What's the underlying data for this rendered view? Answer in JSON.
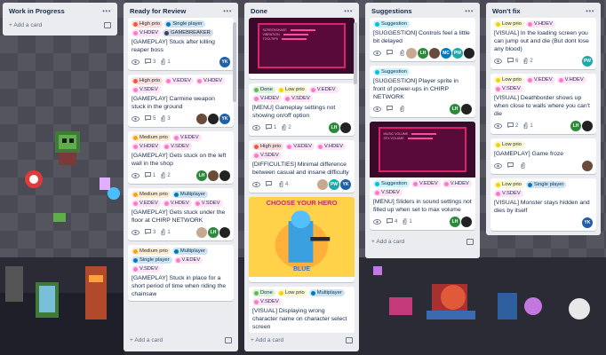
{
  "colors": {
    "yellow": "#f2d600",
    "green": "#61bd4f",
    "orange": "#ff9f1a",
    "red": "#eb5a46",
    "purple": "#c377e0",
    "pink": "#ff78cb",
    "blue": "#0079bf",
    "teal": "#00c2e0",
    "black": "#344563"
  },
  "add_card": "+ Add a card",
  "lists": [
    {
      "title": "Work in Progress",
      "cards": []
    },
    {
      "title": "Ready for Review",
      "cards": [
        {
          "labels": [
            {
              "t": "High prio",
              "c": "red"
            },
            {
              "t": "Single player",
              "c": "blue"
            },
            {
              "t": "V.HDEV",
              "c": "pink"
            },
            {
              "t": "GAMEBREAKER",
              "c": "black"
            }
          ],
          "title": "[GAMEPLAY] Stuck after killing reaper boss",
          "badges": {
            "watch": true,
            "comments": "3",
            "attach": "1"
          },
          "members": [
            "YK"
          ]
        },
        {
          "labels": [
            {
              "t": "High prio",
              "c": "red"
            },
            {
              "t": "V.EDEV",
              "c": "pink"
            },
            {
              "t": "V.HDEV",
              "c": "pink"
            },
            {
              "t": "V.SDEV",
              "c": "pink"
            }
          ],
          "title": "[GAMEPLAY] Carmine weapon stuck in the ground",
          "badges": {
            "watch": true,
            "comments": "5",
            "attach": "3"
          },
          "members": [
            "av-1",
            "av-2",
            "YK"
          ]
        },
        {
          "labels": [
            {
              "t": "Medium prio",
              "c": "orange"
            },
            {
              "t": "V.EDEV",
              "c": "pink"
            },
            {
              "t": "V.HDEV",
              "c": "pink"
            },
            {
              "t": "V.SDEV",
              "c": "pink"
            }
          ],
          "title": "[GAMEPLAY] Gets stuck on the left wall in the shop",
          "badges": {
            "watch": true,
            "comments": "1",
            "attach": "2"
          },
          "members": [
            "LH",
            "av-1",
            "av-2"
          ]
        },
        {
          "labels": [
            {
              "t": "Medium prio",
              "c": "orange"
            },
            {
              "t": "Multiplayer",
              "c": "blue"
            },
            {
              "t": "V.EDEV",
              "c": "pink"
            },
            {
              "t": "V.HDEV",
              "c": "pink"
            },
            {
              "t": "V.SDEV",
              "c": "pink"
            }
          ],
          "title": "[GAMEPLAY] Gets stuck under the floor at CHIRP NETWORK",
          "badges": {
            "watch": true,
            "comments": "3",
            "attach": "1"
          },
          "members": [
            "av-3",
            "LH",
            "av-2"
          ]
        },
        {
          "labels": [
            {
              "t": "Medium prio",
              "c": "orange"
            },
            {
              "t": "Multiplayer",
              "c": "blue"
            },
            {
              "t": "Single player",
              "c": "blue"
            },
            {
              "t": "V.EDEV",
              "c": "pink"
            },
            {
              "t": "V.SDEV",
              "c": "pink"
            }
          ],
          "title": "[GAMEPLAY] Stuck in place for a short period of time when riding the chainsaw",
          "badges": null,
          "members": []
        }
      ]
    },
    {
      "title": "Done",
      "cards": [
        {
          "cover": "menu-settings",
          "labels": [],
          "title": "",
          "badges": null,
          "members": []
        },
        {
          "labels": [
            {
              "t": "Done",
              "c": "green"
            },
            {
              "t": "Low prio",
              "c": "yellow"
            },
            {
              "t": "V.EDEV",
              "c": "pink"
            },
            {
              "t": "V.HDEV",
              "c": "pink"
            },
            {
              "t": "V.SDEV",
              "c": "pink"
            }
          ],
          "title": "[MENU] Gameplay settings not showing on/off option",
          "badges": {
            "watch": true,
            "comments": "1",
            "attach": "2"
          },
          "members": [
            "LH",
            "av-2"
          ]
        },
        {
          "labels": [
            {
              "t": "High prio",
              "c": "red"
            },
            {
              "t": "V.EDEV",
              "c": "pink"
            },
            {
              "t": "V.HDEV",
              "c": "pink"
            },
            {
              "t": "V.SDEV",
              "c": "pink"
            }
          ],
          "title": "[DIFFICULTIES] Minimal difference between casual and insane difficulty",
          "badges": {
            "watch": true,
            "comments": "",
            "attach": "4"
          },
          "members": [
            "av-3",
            "PW",
            "YK"
          ]
        },
        {
          "cover": "choose-hero",
          "labels": [],
          "title": "",
          "badges": null,
          "members": []
        },
        {
          "labels": [
            {
              "t": "Done",
              "c": "green"
            },
            {
              "t": "Low prio",
              "c": "yellow"
            },
            {
              "t": "Multiplayer",
              "c": "blue"
            },
            {
              "t": "V.SDEV",
              "c": "pink"
            }
          ],
          "title": "[VISUAL] Displaying wrong character name on character select screen",
          "badges": null,
          "members": []
        }
      ]
    },
    {
      "title": "Suggestions",
      "cards": [
        {
          "labels": [
            {
              "t": "Suggestion",
              "c": "teal"
            }
          ],
          "title": "[SUGGESTION] Controls feel a little bit delayed",
          "badges": {
            "watch": true,
            "comments": "",
            "attach": ""
          },
          "members": [
            "av-3",
            "LH",
            "av-1",
            "MC",
            "PW",
            "av-2",
            "YK"
          ]
        },
        {
          "labels": [
            {
              "t": "Suggestion",
              "c": "teal"
            }
          ],
          "title": "[SUGGESTION] Player sprite in front of power-ups in CHIRP NETWORK",
          "badges": {
            "watch": true,
            "comments": "",
            "attach": ""
          },
          "members": [
            "LH",
            "av-2"
          ]
        },
        {
          "cover": "music-volume",
          "labels": [
            {
              "t": "Suggestion",
              "c": "teal"
            },
            {
              "t": "V.EDEV",
              "c": "pink"
            },
            {
              "t": "V.HDEV",
              "c": "pink"
            },
            {
              "t": "V.SDEV",
              "c": "pink"
            }
          ],
          "title": "[MENU] Sliders in sound settings not filled up when set to max volume",
          "badges": {
            "watch": true,
            "comments": "4",
            "attach": "1"
          },
          "members": [
            "LH",
            "av-2"
          ]
        }
      ]
    },
    {
      "title": "Won't fix",
      "cards": [
        {
          "labels": [
            {
              "t": "Low prio",
              "c": "yellow"
            },
            {
              "t": "V.HDEV",
              "c": "pink"
            }
          ],
          "title": "[VISUAL] In the loading screen you can jump out and die (But dont lose any blood)",
          "badges": {
            "watch": true,
            "comments": "6",
            "attach": "2"
          },
          "members": [
            "PW"
          ]
        },
        {
          "labels": [
            {
              "t": "Low prio",
              "c": "yellow"
            },
            {
              "t": "V.EDEV",
              "c": "pink"
            },
            {
              "t": "V.HDEV",
              "c": "pink"
            },
            {
              "t": "V.SDEV",
              "c": "pink"
            }
          ],
          "title": "[VISUAL] Deathborder shows up when close to walls where you can't die",
          "badges": {
            "watch": true,
            "comments": "2",
            "attach": "1"
          },
          "members": [
            "LH",
            "av-2"
          ]
        },
        {
          "labels": [
            {
              "t": "Low prio",
              "c": "yellow"
            }
          ],
          "title": "[GAMEPLAY] Game froze",
          "badges": {
            "watch": true,
            "comments": "",
            "attach": ""
          },
          "members": [
            "av-1"
          ]
        },
        {
          "labels": [
            {
              "t": "Low prio",
              "c": "yellow"
            },
            {
              "t": "Single player",
              "c": "blue"
            },
            {
              "t": "V.SDEV",
              "c": "pink"
            }
          ],
          "title": "[VISUAL] Monster stays hidden and dies by itself",
          "badges": null,
          "members": [
            "YK"
          ]
        }
      ]
    }
  ],
  "cover_text": {
    "menu_items": [
      "SCREENSHAKE",
      "VIBRATION",
      "TOOLTIPS"
    ],
    "volume_items": [
      "MUSIC VOLUME",
      "SFX VOLUME"
    ],
    "hero_title": "CHOOSE YOUR HERO",
    "hero_name": "BLUE"
  }
}
